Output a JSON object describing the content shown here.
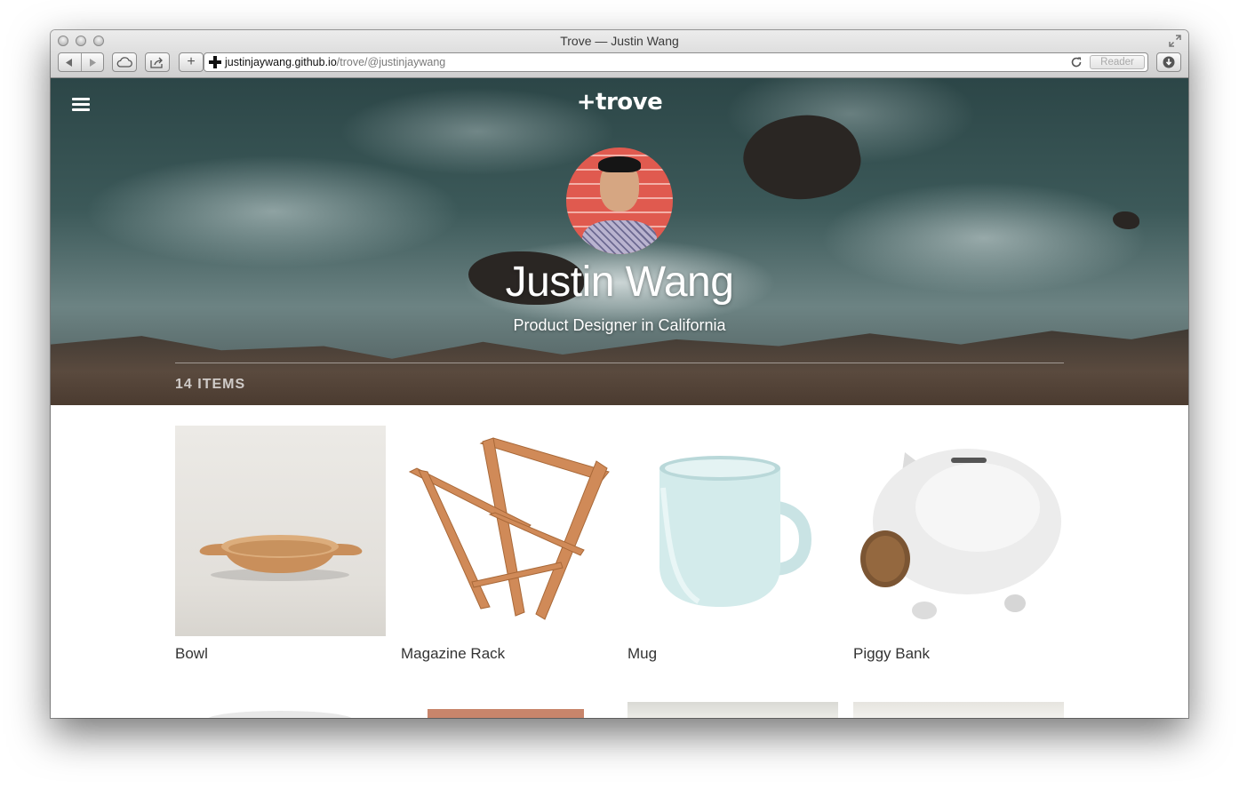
{
  "browser": {
    "window_title": "Trove — Justin Wang",
    "url_host": "justinjaywang.github.io",
    "url_path": "/trove/@justinjaywang",
    "reader_label": "Reader",
    "add_label": "+"
  },
  "header": {
    "logo": "+trove"
  },
  "profile": {
    "name": "Justin Wang",
    "tagline": "Product Designer in California",
    "items_count": "14 ITEMS"
  },
  "items": [
    {
      "label": "Bowl"
    },
    {
      "label": "Magazine Rack"
    },
    {
      "label": "Mug"
    },
    {
      "label": "Piggy Bank"
    }
  ]
}
